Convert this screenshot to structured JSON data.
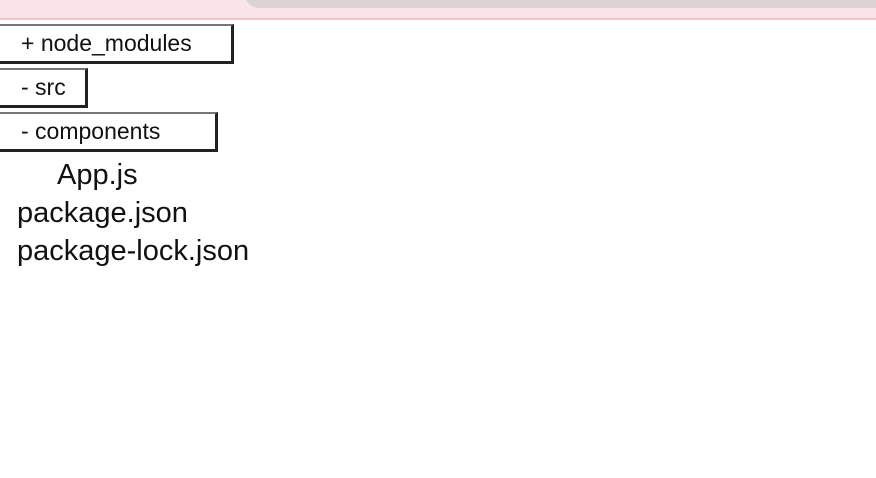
{
  "tree": {
    "folders": [
      {
        "label": "+ node_modules",
        "expanded": false
      },
      {
        "label": "- src",
        "expanded": true
      },
      {
        "label": "- components",
        "expanded": true
      }
    ],
    "files": [
      {
        "label": "App.js"
      },
      {
        "label": "package.json"
      },
      {
        "label": "package-lock.json"
      }
    ]
  },
  "colors": {
    "top_strip": "#f9e4e8",
    "top_tab": "#dcd2d4",
    "text": "#111111",
    "button_border_dark": "#222222",
    "button_border_light": "#767676"
  }
}
